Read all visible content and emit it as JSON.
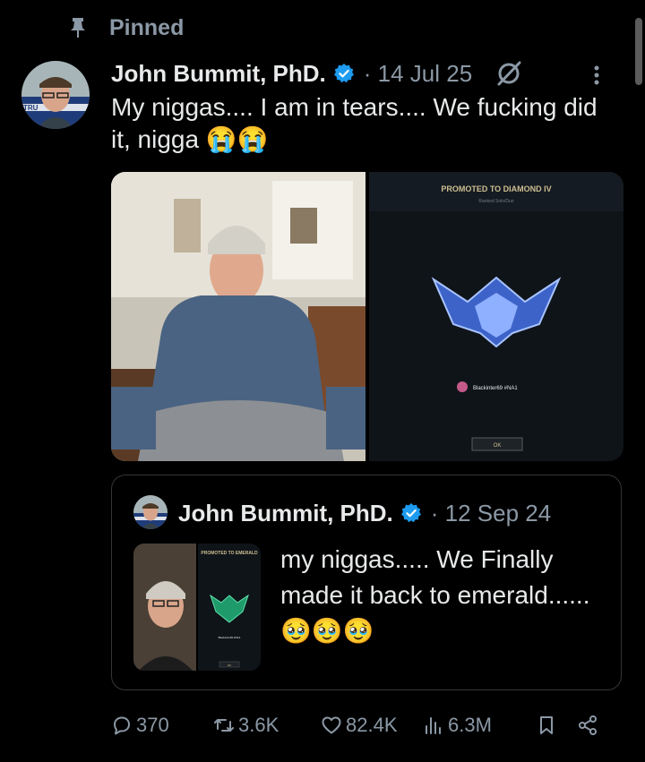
{
  "pinned": {
    "label": "Pinned"
  },
  "tweet": {
    "author": "John Bummit, PhD.",
    "date": "· 14 Jul 25",
    "text": "My niggas.... I am in tears.... We fucking did it, nigga 😭😭",
    "media": [
      {
        "type": "photo",
        "icon": "photo-man-sitting"
      },
      {
        "type": "game-screenshot",
        "banner": "PROMOTED TO DIAMOND IV",
        "subtitle": "Ranked Solo/Duo",
        "player": "Blackinter69 #NA1",
        "button": "OK"
      }
    ]
  },
  "quote": {
    "author": "John Bummit, PhD.",
    "date": "· 12 Sep 24",
    "text": "my niggas..... We Finally made it back to emerald...... 🥹🥹🥹",
    "thumb": {
      "banner": "PROMOTED TO EMERALD",
      "player": "Blackinter69 #NA1",
      "button": "OK"
    }
  },
  "actions": {
    "replies": "370",
    "reposts": "3.6K",
    "likes": "82.4K",
    "views": "6.3M"
  },
  "colors": {
    "accent": "#1d9bf0",
    "muted": "#8b98a5",
    "text": "#e7e9ea",
    "border": "#333639"
  }
}
